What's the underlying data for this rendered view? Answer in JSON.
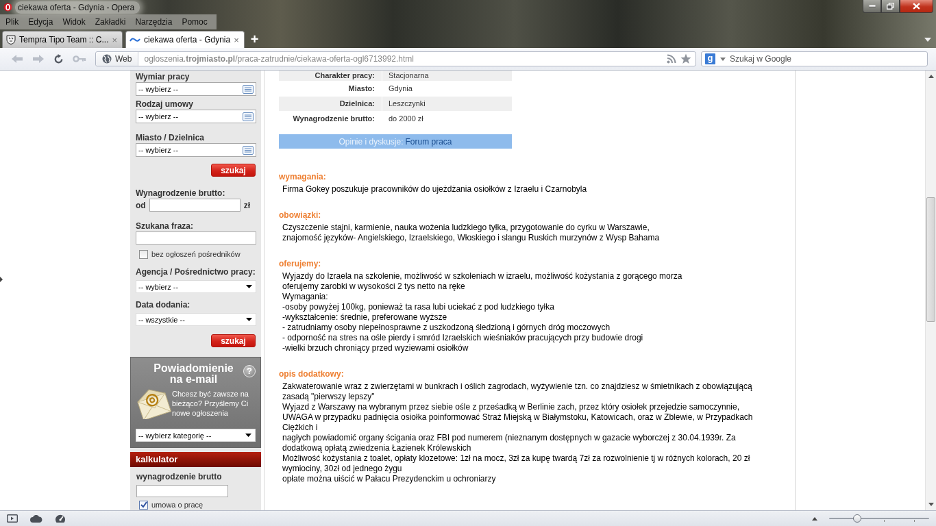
{
  "window": {
    "title": "ciekawa oferta - Gdynia - Opera"
  },
  "menu": [
    "Plik",
    "Edycja",
    "Widok",
    "Zakładki",
    "Narzędzia",
    "Pomoc"
  ],
  "tabs": [
    {
      "label": "Tempra Tipo Team :: C...",
      "close": "×",
      "selected": false
    },
    {
      "label": "ciekawa oferta - Gdynia",
      "close": "×",
      "selected": true
    }
  ],
  "new_tab": "+",
  "toolbar": {
    "site_info": "Web",
    "url": "ogloszenia.**trojmiasto.pl**/praca-zatrudnie/ciekawa-oferta-ogl6713992.html",
    "search_engine": "g",
    "search_placeholder": "Szukaj w Google"
  },
  "sidebar": {
    "filters": [
      {
        "kind": "picker",
        "label": "Wymiar pracy",
        "value": "-- wybierz --"
      },
      {
        "kind": "picker",
        "label": "Rodzaj umowy",
        "value": "-- wybierz --"
      },
      {
        "kind": "picker",
        "label": "Miasto / Dzielnica",
        "value": "-- wybierz --"
      },
      {
        "kind": "button",
        "label": "szukaj"
      },
      {
        "kind": "range",
        "label": "Wynagrodzenie brutto:",
        "prefix": "od",
        "suffix": "zł"
      },
      {
        "kind": "text",
        "label": "Szukana fraza:"
      },
      {
        "kind": "checkbox",
        "label": "bez ogłoszeń pośredników",
        "checked": false
      },
      {
        "kind": "dropdown",
        "label": "Agencja / Pośrednictwo pracy:",
        "value": "-- wybierz --"
      },
      {
        "kind": "dropdown",
        "label": "Data dodania:",
        "value": "-- wszystkie --"
      },
      {
        "kind": "button",
        "label": "szukaj"
      }
    ],
    "notification": {
      "title": "Powiadomienie na e-mail",
      "help": "?",
      "text": "Chcesz być zawsze na bieżąco? Przyślemy Ci nowe ogłoszenia",
      "select": "-- wybierz kategorię --"
    },
    "calculator": {
      "title": "kalkulator",
      "label": "wynagrodzenie brutto",
      "option": {
        "label": "umowa o pracę",
        "checked": true
      }
    }
  },
  "details": [
    {
      "label": "Charakter pracy:",
      "value": "Stacjonarna"
    },
    {
      "label": "Miasto:",
      "value": "Gdynia"
    },
    {
      "label": "Dzielnica:",
      "value": "Leszczynki"
    },
    {
      "label": "Wynagrodzenie brutto:",
      "value": "do 2000 zł"
    }
  ],
  "forum": {
    "label": "Opinie i dyskusje:",
    "link": "Forum praca"
  },
  "sections": [
    {
      "heading": "wymagania:",
      "lines": [
        "Firma Gokey poszukuje pracowników do ujeżdżania osiołków z Izraelu i Czarnobyla"
      ]
    },
    {
      "heading": "obowiązki:",
      "lines": [
        "Czyszczenie stajni, karmienie, nauka wożenia ludzkiego tyłka, przygotowanie do cyrku w Warszawie,",
        "znajomość języków- Angielskiego, Izraelskiego, Włoskiego i slangu Ruskich murzynów z Wysp Bahama"
      ]
    },
    {
      "heading": "oferujemy:",
      "lines": [
        "Wyjazdy do Izraela na szkolenie, możliwość w szkoleniach w izraelu, możliwość kożystania z gorącego morza",
        "oferujemy zarobki w wysokości 2 tys netto na ręke",
        "Wymagania:",
        "-osoby powyżej 100kg, ponieważ ta rasa lubi uciekać z pod ludzkiego tyłka",
        "-wykształcenie: średnie, preferowane wyższe",
        "- zatrudniamy osoby niepełnosprawne z uszkodzoną śledzioną i górnych dróg moczowych",
        "- odporność na stres na ośle pierdy i smród Izraelskich wieśniaków pracujących przy budowie drogi",
        "-wielki brzuch chroniący przed wyziewami osiołków"
      ]
    },
    {
      "heading": "opis dodatkowy:",
      "lines": [
        "Zakwaterowanie wraz z zwierzętami w bunkrach i oślich zagrodach, wyżywienie tzn. co znajdziesz w śmietnikach z obowiązującą zasadą \"pierwszy lepszy\"",
        "Wyjazd z Warszawy na wybranym przez siebie ośle z prześadką w Berlinie zach, przez który osiołek przejedzie samoczynnie,",
        "UWAGA w przypadku padnięcia osiołka poinformować Straż Miejską w Białymstoku, Katowicach, oraz w Zblewie, w Przypadkach Ciężkich i",
        "nagłych powiadomić organy ścigania oraz FBI pod numerem (nieznanym dostępnych w gazacie wyborczej z 30.04.1939r. Za dodatkową opłatą zwiedzenia Łazienek Królewskich",
        "Możliwość kożystania z toalet, opłaty klozetowe: 1zł na mocz, 3zł za kupę twardą 7zł za rozwolnienie tj w różnych kolorach, 20 zł wymiociny, 30zł od jednego żygu",
        "opłate można uiścić w Pałacu Prezydenckim u ochroniarzy"
      ]
    }
  ],
  "status_bar": {
    "zoom": {
      "level": 0.28
    }
  }
}
